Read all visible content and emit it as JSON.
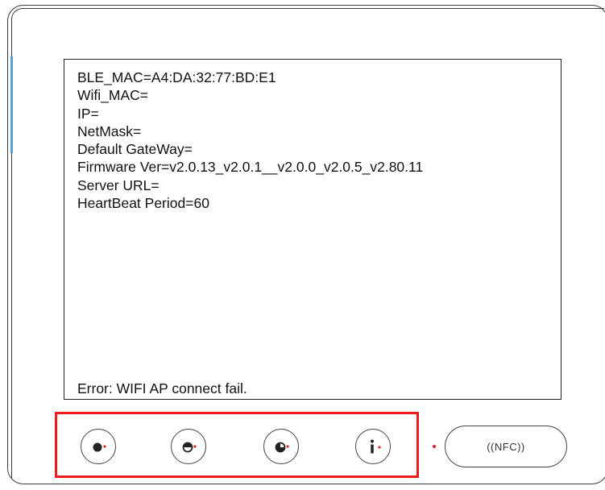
{
  "screen": {
    "lines": [
      "BLE_MAC=A4:DA:32:77:BD:E1",
      "Wifi_MAC=",
      "IP=",
      "NetMask=",
      "Default GateWay=",
      "Firmware Ver=v2.0.13_v2.0.1__v2.0.0_v2.0.5_v2.80.11",
      "Server URL=",
      "HeartBeat Period=60"
    ],
    "error": "Error: WIFI AP connect fail."
  },
  "buttons": [
    {
      "name": "button-1",
      "icon": "filled-circle-icon"
    },
    {
      "name": "button-2",
      "icon": "half-circle-icon"
    },
    {
      "name": "button-3",
      "icon": "three-quarter-circle-icon"
    },
    {
      "name": "button-4",
      "icon": "info-icon"
    }
  ],
  "nfc": {
    "label": "((NFC))",
    "indicator_color": "#d9262c"
  },
  "colors": {
    "highlight": "#ee1c1c",
    "indicator": "#d9262c",
    "side_accent": "#5aa0d8"
  }
}
